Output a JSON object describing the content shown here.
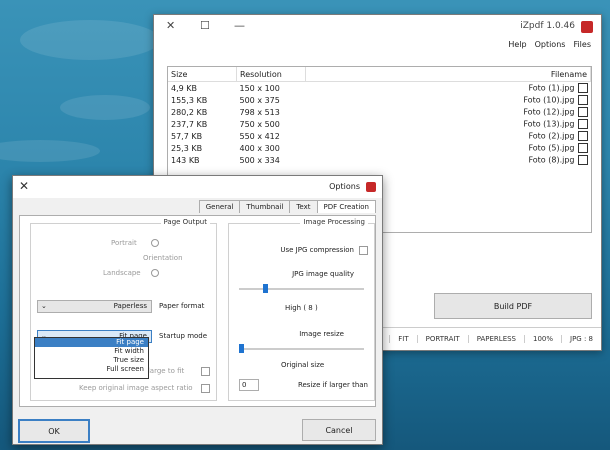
{
  "main_window": {
    "title": "iZpdf 1.0.46",
    "menu": [
      "Files",
      "Options",
      "Help"
    ],
    "columns": [
      "Filename",
      "Resolution",
      "Size"
    ],
    "files": [
      {
        "name": "Foto (1).jpg",
        "resolution": "150 x 100",
        "size": "4,9 KB"
      },
      {
        "name": "Foto (10).jpg",
        "resolution": "500 x 375",
        "size": "155,3 KB"
      },
      {
        "name": "Foto (12).jpg",
        "resolution": "798 x 513",
        "size": "280,2 KB"
      },
      {
        "name": "Foto (13).jpg",
        "resolution": "750 x 500",
        "size": "237,7 KB"
      },
      {
        "name": "Foto (2).jpg",
        "resolution": "550 x 412",
        "size": "57,7 KB"
      },
      {
        "name": "Foto (5).jpg",
        "resolution": "400 x 300",
        "size": "25,3 KB"
      },
      {
        "name": "Foto (8).jpg",
        "resolution": "500 x 334",
        "size": "143 KB"
      }
    ],
    "build_label": "Build PDF",
    "status": [
      "JPG : 8",
      "100%",
      "PAPERLESS",
      "PORTRAIT",
      "FIT"
    ]
  },
  "options": {
    "title": "Options",
    "tabs": [
      "PDF Creation",
      "Text",
      "Thumbnail",
      "General"
    ],
    "image_processing": {
      "legend": "Image Processing",
      "use_jpg": "Use JPG compression",
      "quality_label": "JPG image quality",
      "quality_value": "High ( 8 )",
      "resize_label": "Image resize",
      "resize_value": "Original size",
      "resize_if": "Resize if larger than",
      "resize_if_value": "0"
    },
    "page_output": {
      "legend": "Page Output",
      "orientation_label": "Orientation",
      "portrait": "Portrait",
      "landscape": "Landscape",
      "paper_label": "Paper format",
      "paper_value": "Paperless",
      "startup_label": "Startup mode",
      "startup_value": "Fit page",
      "startup_options": [
        "Fit page",
        "Fit width",
        "True size",
        "Full screen"
      ],
      "enlarge": "Enlarge to fit",
      "keep_ratio": "Keep original image aspect ratio"
    },
    "ok": "OK",
    "cancel": "Cancel"
  },
  "colors": {
    "accent": "#3b7fc4",
    "app_icon": "#c62828"
  }
}
